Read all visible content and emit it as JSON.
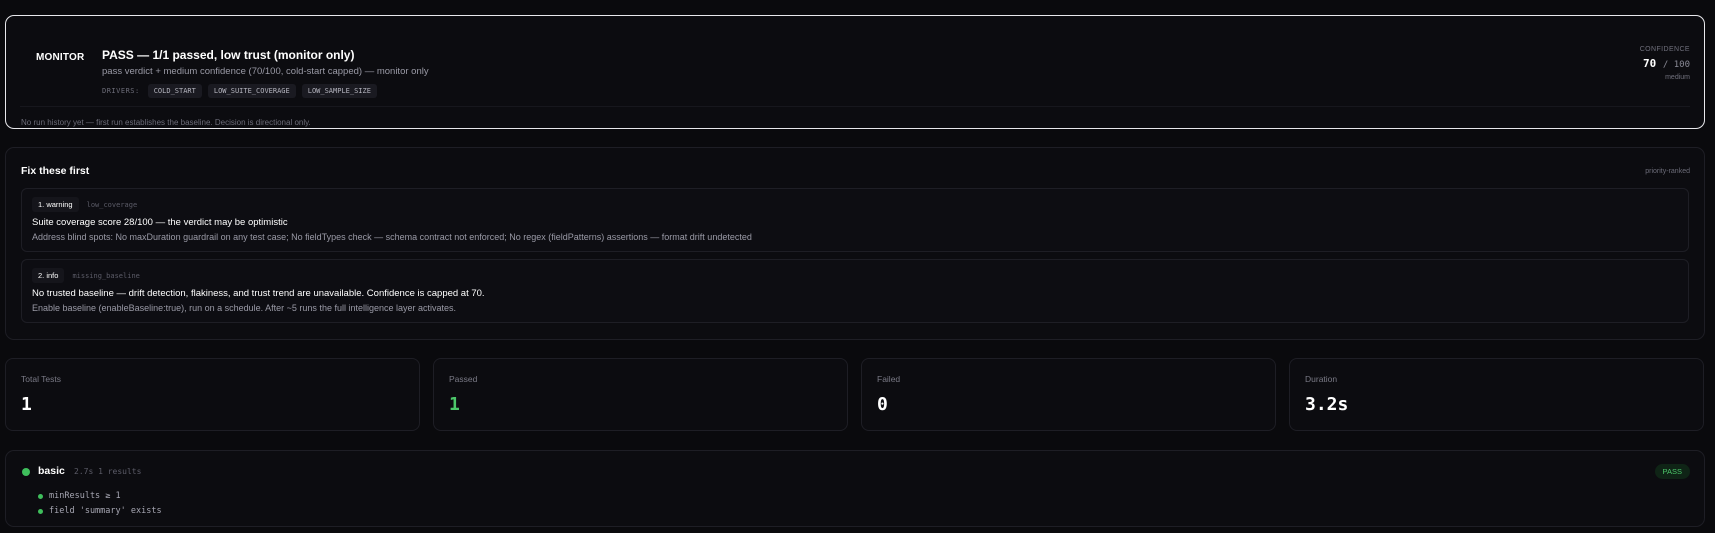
{
  "verdict": {
    "badge": "MONITOR",
    "headline": "PASS — 1/1 passed, low trust (monitor only)",
    "sub": "pass verdict + medium confidence (70/100, cold-start capped) — monitor only",
    "drivers_label": "DRIVERS:",
    "drivers": [
      "COLD_START",
      "LOW_SUITE_COVERAGE",
      "LOW_SAMPLE_SIZE"
    ],
    "note": "No run history yet — first run establishes the baseline. Decision is directional only.",
    "confidence": {
      "label": "CONFIDENCE",
      "value": "70",
      "max": "/ 100",
      "level": "medium"
    }
  },
  "fix": {
    "title": "Fix these first",
    "rank_label": "priority-ranked",
    "issues": [
      {
        "severity": "1. warning",
        "code": "low_coverage",
        "title": "Suite coverage score 28/100 — the verdict may be optimistic",
        "detail": "Address blind spots: No maxDuration guardrail on any test case; No fieldTypes check — schema contract not enforced; No regex (fieldPatterns) assertions — format drift undetected"
      },
      {
        "severity": "2. info",
        "code": "missing_baseline",
        "title": "No trusted baseline — drift detection, flakiness, and trust trend are unavailable. Confidence is capped at 70.",
        "detail": "Enable baseline (enableBaseline:true), run on a schedule. After ~5 runs the full intelligence layer activates."
      }
    ]
  },
  "stats": [
    {
      "label": "Total Tests",
      "value": "1"
    },
    {
      "label": "Passed",
      "value": "1"
    },
    {
      "label": "Failed",
      "value": "0"
    },
    {
      "label": "Duration",
      "value": "3.2s"
    }
  ],
  "suite": {
    "name": "basic",
    "meta": "2.7s  1 results",
    "status": "PASS",
    "assertions": [
      "minResults ≥ 1",
      "field 'summary' exists"
    ]
  },
  "colors": {
    "pass": "#4cc76a",
    "border_active": "#e8e8ec"
  }
}
